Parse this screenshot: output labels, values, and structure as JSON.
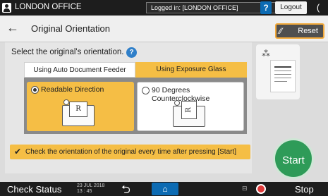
{
  "topbar": {
    "location": "LONDON OFFICE",
    "logged_in": "Logged in: [LONDON OFFICE]",
    "help_label": "?",
    "logout_label": "Logout",
    "power_symbol": "("
  },
  "titlebar": {
    "back_symbol": "←",
    "title": "Original Orientation",
    "reset_label": "Reset",
    "reset_icon": "eraser-icon"
  },
  "main": {
    "prompt": "Select the original's orientation.",
    "help_symbol": "?",
    "tabs": [
      {
        "label": "Using Auto Document Feeder",
        "selected": false
      },
      {
        "label": "Using Exposure Glass",
        "selected": true
      }
    ],
    "options": [
      {
        "label": "Readable Direction",
        "selected": true,
        "glyph": "R"
      },
      {
        "label": "90 Degrees Counterclockwise",
        "selected": false,
        "glyph": "R"
      }
    ],
    "check_text": "Check the orientation of the original every time after pressing [Start]",
    "check_symbol": "✔"
  },
  "right": {
    "start_label": "Start",
    "dots_symbol": "⁂"
  },
  "bottombar": {
    "check_status": "Check Status",
    "date": "23 JUL 2018",
    "time": "13 : 45",
    "back_symbol": "⮌",
    "home_symbol": "⌂",
    "memory_symbol": "⊟",
    "stop_label": "Stop"
  },
  "colors": {
    "accent_yellow": "#f5be45",
    "start_green": "#2e9b58",
    "help_blue": "#0c6bb3",
    "stop_red": "#e03a3a"
  }
}
